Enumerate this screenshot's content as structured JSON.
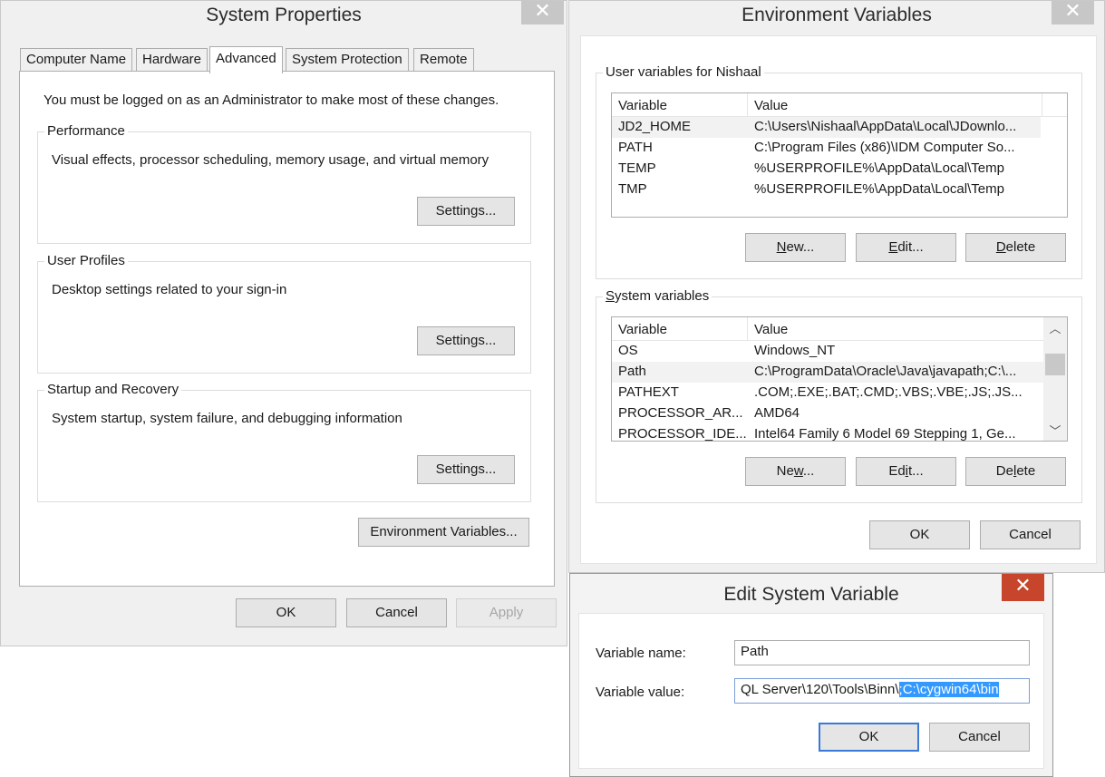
{
  "system_properties": {
    "title": "System Properties",
    "close_glyph": "✕",
    "tabs": [
      "Computer Name",
      "Hardware",
      "Advanced",
      "System Protection",
      "Remote"
    ],
    "active_tab": "Advanced",
    "admin_notice": "You must be logged on as an Administrator to make most of these changes.",
    "performance": {
      "label": "Performance",
      "description": "Visual effects, processor scheduling, memory usage, and virtual memory",
      "button": "Settings..."
    },
    "user_profiles": {
      "label": "User Profiles",
      "description": "Desktop settings related to your sign-in",
      "button": "Settings..."
    },
    "startup_recovery": {
      "label": "Startup and Recovery",
      "description": "System startup, system failure, and debugging information",
      "button": "Settings..."
    },
    "env_button": "Environment Variables...",
    "ok": "OK",
    "cancel": "Cancel",
    "apply": "Apply"
  },
  "environment_variables": {
    "title": "Environment Variables",
    "close_glyph": "✕",
    "user_group_label": "User variables for Nishaal",
    "col_variable": "Variable",
    "col_value": "Value",
    "user_vars": [
      {
        "variable": "JD2_HOME",
        "value": "C:\\Users\\Nishaal\\AppData\\Local\\JDownlo..."
      },
      {
        "variable": "PATH",
        "value": "C:\\Program Files (x86)\\IDM Computer So..."
      },
      {
        "variable": "TEMP",
        "value": "%USERPROFILE%\\AppData\\Local\\Temp"
      },
      {
        "variable": "TMP",
        "value": "%USERPROFILE%\\AppData\\Local\\Temp"
      }
    ],
    "system_group_label": "System variables",
    "system_vars": [
      {
        "variable": "OS",
        "value": "Windows_NT"
      },
      {
        "variable": "Path",
        "value": "C:\\ProgramData\\Oracle\\Java\\javapath;C:\\..."
      },
      {
        "variable": "PATHEXT",
        "value": ".COM;.EXE;.BAT;.CMD;.VBS;.VBE;.JS;.JS..."
      },
      {
        "variable": "PROCESSOR_AR...",
        "value": "AMD64"
      },
      {
        "variable": "PROCESSOR_IDE...",
        "value": "Intel64 Family 6 Model 69 Stepping 1, Ge..."
      }
    ],
    "scroll_up_glyph": "︿",
    "scroll_down_glyph": "﹀",
    "new_label": "New...",
    "edit_label": "Edit...",
    "delete_label": "Delete",
    "ok": "OK",
    "cancel": "Cancel"
  },
  "edit_system_variable": {
    "title": "Edit System Variable",
    "close_glyph": "✕",
    "name_label": "Variable name:",
    "name_value": "Path",
    "value_label": "Variable value:",
    "value_prefix": "QL Server\\120\\Tools\\Binn\\",
    "value_selected": ";C:\\cygwin64\\bin",
    "ok": "OK",
    "cancel": "Cancel"
  }
}
